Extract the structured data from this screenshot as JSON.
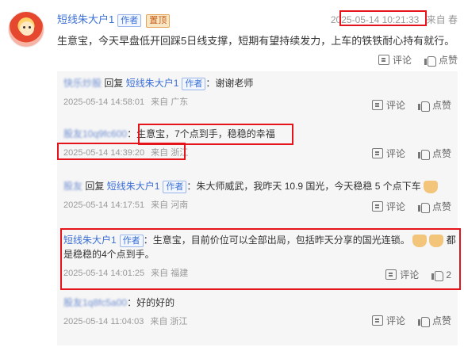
{
  "post": {
    "author": "短线朱大户1",
    "author_tag": "作者",
    "vip_tag": "置顶",
    "timestamp": "2025-05-14 10:21:33",
    "source": "来自 春",
    "text": "生意宝，今天早盘低开回踩5日线支撑，短期有望持续发力，上车的铁铁耐心持有就行。",
    "comment_label": "评论",
    "like_label": "点赞"
  },
  "replies": [
    {
      "user": "快乐炒股",
      "reply_word": "回复",
      "target": "短线朱大户1",
      "target_tag": "作者",
      "text": "：谢谢老师",
      "time": "2025-05-14 14:58:01",
      "source": "来自 广东",
      "comment_label": "评论",
      "like_label": "点赞"
    },
    {
      "user": "股友10q9fc600",
      "text": "：生意宝，7个点到手，稳稳的幸福",
      "time": "2025-05-14 14:39:20",
      "source": "来自 浙江",
      "comment_label": "评论",
      "like_label": "点赞"
    },
    {
      "user": "股友",
      "reply_word": "回复",
      "target": "短线朱大户1",
      "target_tag": "作者",
      "text": "：朱大师威武，我昨天 10.9 国光，今天稳稳 5 个点下车",
      "time": "2025-05-14 14:17:51",
      "source": "来自 河南",
      "comment_label": "评论",
      "like_label": "点赞"
    },
    {
      "user": "短线朱大户1",
      "user_tag": "作者",
      "text_line1": "：生意宝，目前价位可以全部出局，包括昨天分享的国光连锁。",
      "text_line1_suffix": "都",
      "text_line2": "是稳稳的4个点到手。",
      "time": "2025-05-14 14:01:25",
      "source": "来自 福建",
      "comment_label": "评论",
      "like_count": "2"
    },
    {
      "user": "股友1q8fc5a00",
      "text": "：好的好的",
      "time": "2025-05-14 11:04:03",
      "source": "来自 浙江",
      "comment_label": "评论",
      "like_label": "点赞"
    }
  ]
}
